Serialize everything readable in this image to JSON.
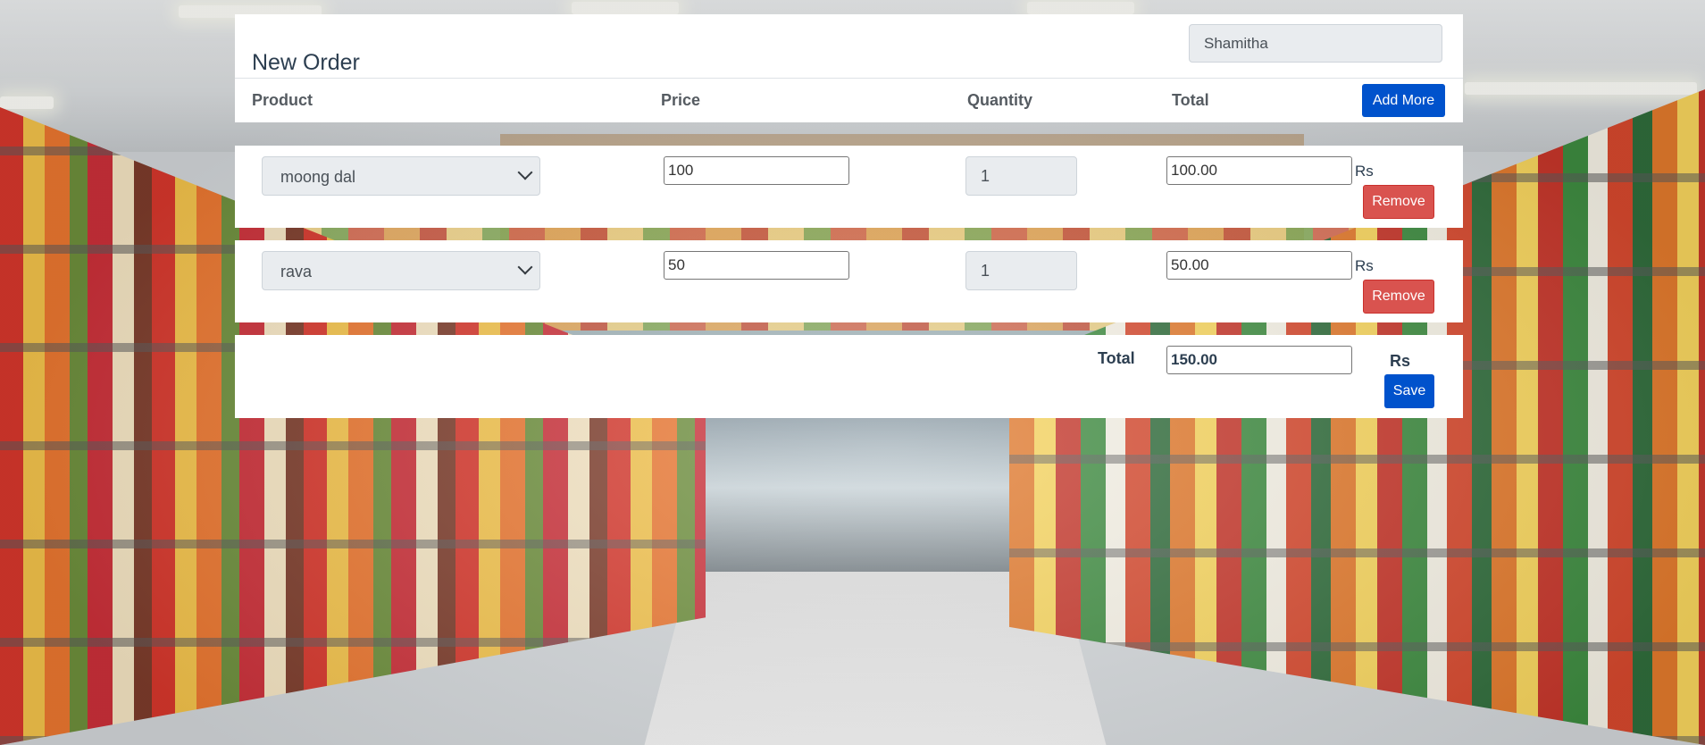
{
  "header": {
    "title": "New Order",
    "customer_name": "Shamitha",
    "add_more_label": "Add More"
  },
  "columns": {
    "product": "Product",
    "price": "Price",
    "quantity": "Quantity",
    "total": "Total"
  },
  "rows": [
    {
      "product": "moong dal",
      "price": "100",
      "quantity": "1",
      "total": "100.00",
      "currency": "Rs",
      "remove_label": "Remove"
    },
    {
      "product": "rava",
      "price": "50",
      "quantity": "1",
      "total": "50.00",
      "currency": "Rs",
      "remove_label": "Remove"
    }
  ],
  "footer": {
    "total_label": "Total",
    "grand_total": "150.00",
    "currency": "Rs",
    "save_label": "Save"
  },
  "colors": {
    "primary": "#0052cc",
    "danger": "#d9534f",
    "heading": "#2c3e50"
  },
  "icons": {
    "dropdown": "chevron-down-icon"
  }
}
